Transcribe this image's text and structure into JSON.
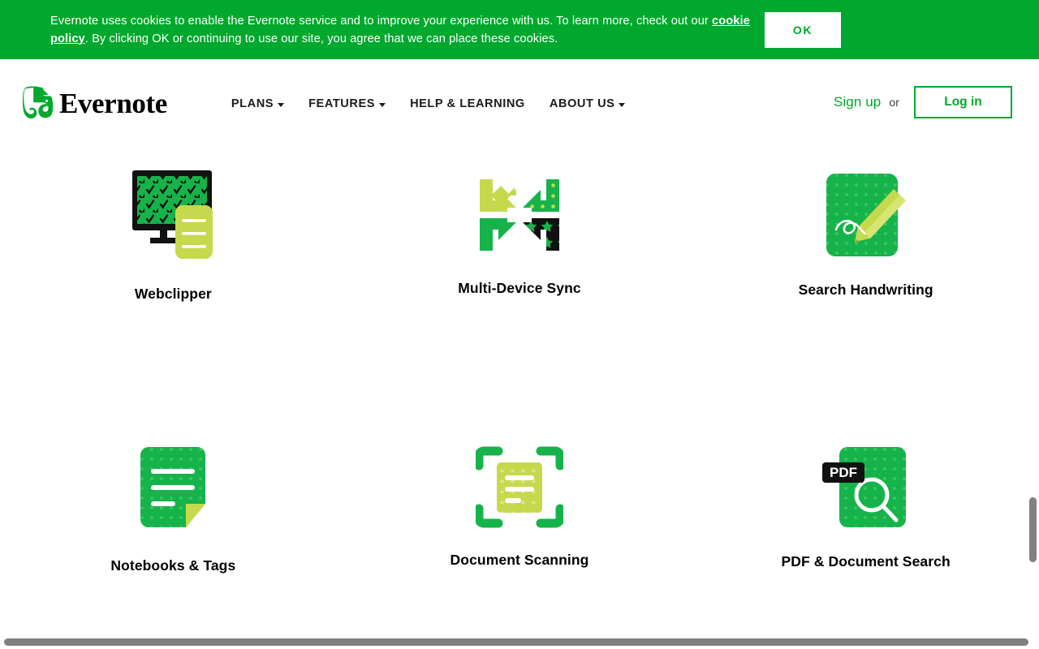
{
  "cookie_banner": {
    "text_before_link": "Evernote uses cookies to enable the Evernote service and to improve your experience with us. To learn more, check out our ",
    "link_label": "cookie policy",
    "text_after_link": ". By clicking OK or continuing to use our site, you agree that we can place these cookies.",
    "ok_label": "OK",
    "background_color": "#00a82d",
    "button_text_color": "#00a82d"
  },
  "header": {
    "brand_name": "Evernote",
    "brand_color": "#00a82d",
    "nav_items": [
      {
        "label": "PLANS",
        "has_caret": true
      },
      {
        "label": "FEATURES",
        "has_caret": true
      },
      {
        "label": "HELP & LEARNING",
        "has_caret": false
      },
      {
        "label": "ABOUT US",
        "has_caret": true
      }
    ],
    "signup_label": "Sign up",
    "or_label": "or",
    "login_label": "Log in",
    "accent_color": "#00a82d"
  },
  "features": [
    {
      "label": "Webclipper",
      "icon": "webclipper-icon"
    },
    {
      "label": "Multi-Device Sync",
      "icon": "multi-device-sync-icon"
    },
    {
      "label": "Search Handwriting",
      "icon": "search-handwriting-icon"
    },
    {
      "label": "Notebooks & Tags",
      "icon": "notebooks-tags-icon"
    },
    {
      "label": "Document Scanning",
      "icon": "document-scanning-icon"
    },
    {
      "label": "PDF & Document Search",
      "icon": "pdf-document-search-icon"
    }
  ],
  "icon_details": {
    "pdf_badge_label": "PDF",
    "green": "#16b34a",
    "dark_green": "#00a82d",
    "lime": "#c6d94d",
    "black": "#111111"
  }
}
